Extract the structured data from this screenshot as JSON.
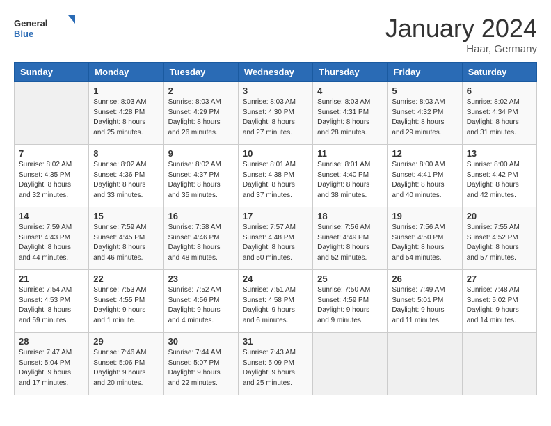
{
  "header": {
    "logo_general": "General",
    "logo_blue": "Blue",
    "month_year": "January 2024",
    "location": "Haar, Germany"
  },
  "days_of_week": [
    "Sunday",
    "Monday",
    "Tuesday",
    "Wednesday",
    "Thursday",
    "Friday",
    "Saturday"
  ],
  "weeks": [
    [
      {
        "day": "",
        "info": ""
      },
      {
        "day": "1",
        "info": "Sunrise: 8:03 AM\nSunset: 4:28 PM\nDaylight: 8 hours\nand 25 minutes."
      },
      {
        "day": "2",
        "info": "Sunrise: 8:03 AM\nSunset: 4:29 PM\nDaylight: 8 hours\nand 26 minutes."
      },
      {
        "day": "3",
        "info": "Sunrise: 8:03 AM\nSunset: 4:30 PM\nDaylight: 8 hours\nand 27 minutes."
      },
      {
        "day": "4",
        "info": "Sunrise: 8:03 AM\nSunset: 4:31 PM\nDaylight: 8 hours\nand 28 minutes."
      },
      {
        "day": "5",
        "info": "Sunrise: 8:03 AM\nSunset: 4:32 PM\nDaylight: 8 hours\nand 29 minutes."
      },
      {
        "day": "6",
        "info": "Sunrise: 8:02 AM\nSunset: 4:34 PM\nDaylight: 8 hours\nand 31 minutes."
      }
    ],
    [
      {
        "day": "7",
        "info": "Sunrise: 8:02 AM\nSunset: 4:35 PM\nDaylight: 8 hours\nand 32 minutes."
      },
      {
        "day": "8",
        "info": "Sunrise: 8:02 AM\nSunset: 4:36 PM\nDaylight: 8 hours\nand 33 minutes."
      },
      {
        "day": "9",
        "info": "Sunrise: 8:02 AM\nSunset: 4:37 PM\nDaylight: 8 hours\nand 35 minutes."
      },
      {
        "day": "10",
        "info": "Sunrise: 8:01 AM\nSunset: 4:38 PM\nDaylight: 8 hours\nand 37 minutes."
      },
      {
        "day": "11",
        "info": "Sunrise: 8:01 AM\nSunset: 4:40 PM\nDaylight: 8 hours\nand 38 minutes."
      },
      {
        "day": "12",
        "info": "Sunrise: 8:00 AM\nSunset: 4:41 PM\nDaylight: 8 hours\nand 40 minutes."
      },
      {
        "day": "13",
        "info": "Sunrise: 8:00 AM\nSunset: 4:42 PM\nDaylight: 8 hours\nand 42 minutes."
      }
    ],
    [
      {
        "day": "14",
        "info": "Sunrise: 7:59 AM\nSunset: 4:43 PM\nDaylight: 8 hours\nand 44 minutes."
      },
      {
        "day": "15",
        "info": "Sunrise: 7:59 AM\nSunset: 4:45 PM\nDaylight: 8 hours\nand 46 minutes."
      },
      {
        "day": "16",
        "info": "Sunrise: 7:58 AM\nSunset: 4:46 PM\nDaylight: 8 hours\nand 48 minutes."
      },
      {
        "day": "17",
        "info": "Sunrise: 7:57 AM\nSunset: 4:48 PM\nDaylight: 8 hours\nand 50 minutes."
      },
      {
        "day": "18",
        "info": "Sunrise: 7:56 AM\nSunset: 4:49 PM\nDaylight: 8 hours\nand 52 minutes."
      },
      {
        "day": "19",
        "info": "Sunrise: 7:56 AM\nSunset: 4:50 PM\nDaylight: 8 hours\nand 54 minutes."
      },
      {
        "day": "20",
        "info": "Sunrise: 7:55 AM\nSunset: 4:52 PM\nDaylight: 8 hours\nand 57 minutes."
      }
    ],
    [
      {
        "day": "21",
        "info": "Sunrise: 7:54 AM\nSunset: 4:53 PM\nDaylight: 8 hours\nand 59 minutes."
      },
      {
        "day": "22",
        "info": "Sunrise: 7:53 AM\nSunset: 4:55 PM\nDaylight: 9 hours\nand 1 minute."
      },
      {
        "day": "23",
        "info": "Sunrise: 7:52 AM\nSunset: 4:56 PM\nDaylight: 9 hours\nand 4 minutes."
      },
      {
        "day": "24",
        "info": "Sunrise: 7:51 AM\nSunset: 4:58 PM\nDaylight: 9 hours\nand 6 minutes."
      },
      {
        "day": "25",
        "info": "Sunrise: 7:50 AM\nSunset: 4:59 PM\nDaylight: 9 hours\nand 9 minutes."
      },
      {
        "day": "26",
        "info": "Sunrise: 7:49 AM\nSunset: 5:01 PM\nDaylight: 9 hours\nand 11 minutes."
      },
      {
        "day": "27",
        "info": "Sunrise: 7:48 AM\nSunset: 5:02 PM\nDaylight: 9 hours\nand 14 minutes."
      }
    ],
    [
      {
        "day": "28",
        "info": "Sunrise: 7:47 AM\nSunset: 5:04 PM\nDaylight: 9 hours\nand 17 minutes."
      },
      {
        "day": "29",
        "info": "Sunrise: 7:46 AM\nSunset: 5:06 PM\nDaylight: 9 hours\nand 20 minutes."
      },
      {
        "day": "30",
        "info": "Sunrise: 7:44 AM\nSunset: 5:07 PM\nDaylight: 9 hours\nand 22 minutes."
      },
      {
        "day": "31",
        "info": "Sunrise: 7:43 AM\nSunset: 5:09 PM\nDaylight: 9 hours\nand 25 minutes."
      },
      {
        "day": "",
        "info": ""
      },
      {
        "day": "",
        "info": ""
      },
      {
        "day": "",
        "info": ""
      }
    ]
  ]
}
